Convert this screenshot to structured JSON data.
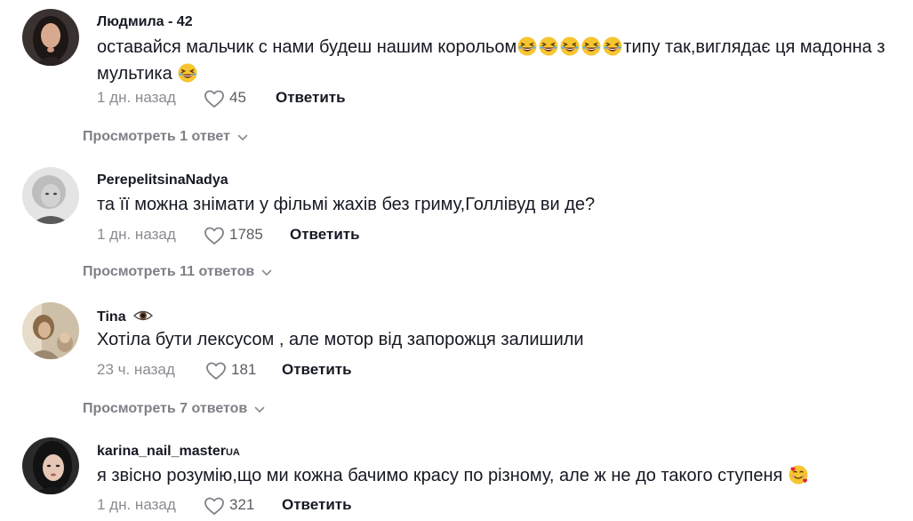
{
  "comments": [
    {
      "username": "Людмила - 42",
      "text_a": "оставайся мальчик с нами будеш нашим корольом",
      "text_b": "типу так,виглядає ця мадонна з мультика",
      "time": "1 дн. назад",
      "likes": "45",
      "reply": "Ответить",
      "view_replies": "Просмотреть 1 ответ"
    },
    {
      "username": "PerepelitsinaNadya",
      "text": "та її можна знімати у фільмі жахів без гриму,Голлівуд ви де?",
      "time": "1 дн. назад",
      "likes": "1785",
      "reply": "Ответить",
      "view_replies": "Просмотреть 11 ответов"
    },
    {
      "username": "Tina",
      "text": "Хотіла бути лексусом , але мотор від запорожця залишили",
      "time": "23 ч. назад",
      "likes": "181",
      "reply": "Ответить",
      "view_replies": "Просмотреть 7 ответов"
    },
    {
      "username": "karina_nail_master",
      "username_suffix": "UA",
      "text": "я звісно розумію,що ми кожна бачимо красу по різному, але ж не до такого ступеня",
      "time": "1 дн. назад",
      "likes": "321",
      "reply": "Ответить"
    }
  ],
  "icons": {
    "like": "heart-outline-icon",
    "expand": "chevron-down-icon",
    "laugh_emoji": "grinning-squinting-face-icon",
    "eye_emoji": "eye-icon",
    "heart_eyes_emoji": "smiling-face-with-hearts-icon"
  },
  "colors": {
    "text": "#161823",
    "meta": "#8a8b91",
    "view_replies": "#7f8087",
    "emoji": "#f7c531"
  }
}
